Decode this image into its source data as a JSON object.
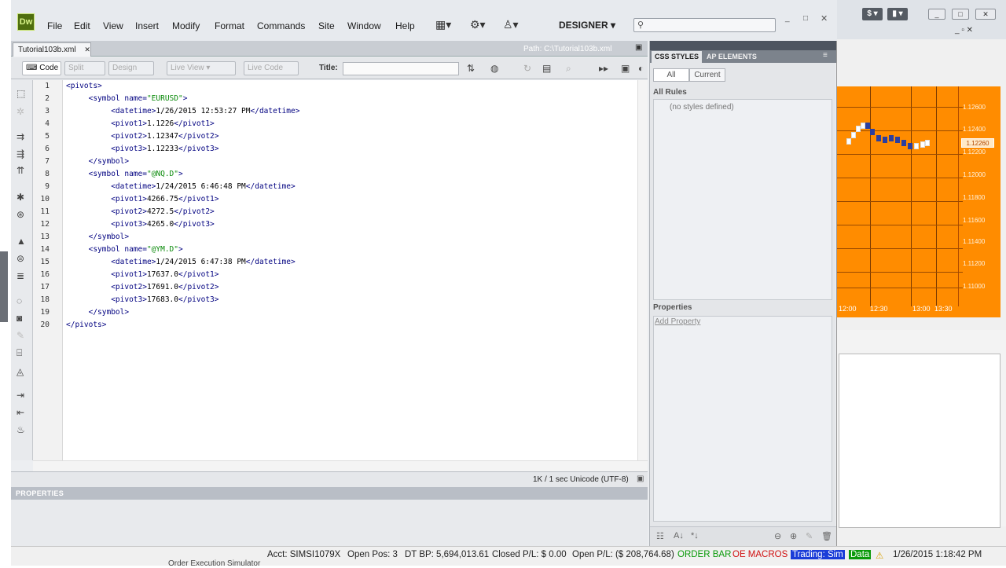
{
  "app": {
    "logo": "Dw",
    "menu": [
      "File",
      "Edit",
      "View",
      "Insert",
      "Modify",
      "Format",
      "Commands",
      "Site",
      "Window",
      "Help"
    ],
    "workspace": "DESIGNER",
    "search_placeholder": ""
  },
  "document": {
    "tab": "Tutorial103b.xml",
    "path": "Path:  C:\\Tutorial103b.xml",
    "toolbar": {
      "code": "Code",
      "split": "Split",
      "design": "Design",
      "live_view": "Live View",
      "live_code": "Live Code",
      "title_label": "Title:",
      "title_value": ""
    },
    "line_numbers": [
      "1",
      "2",
      "3",
      "4",
      "5",
      "6",
      "7",
      "8",
      "9",
      "10",
      "11",
      "12",
      "13",
      "14",
      "15",
      "16",
      "17",
      "18",
      "19",
      "20"
    ],
    "code_lines": [
      [
        {
          "t": "<pivots>",
          "c": "tg"
        }
      ],
      [
        {
          "t": "     <symbol name=",
          "c": "tg"
        },
        {
          "t": "\"EURUSD\"",
          "c": "av"
        },
        {
          "t": ">",
          "c": "tg"
        }
      ],
      [
        {
          "t": "          <datetime>",
          "c": "tg"
        },
        {
          "t": "1/26/2015 12:53:27 PM",
          "c": "tx"
        },
        {
          "t": "</datetime>",
          "c": "tg"
        }
      ],
      [
        {
          "t": "          <pivot1>",
          "c": "tg"
        },
        {
          "t": "1.1226",
          "c": "tx"
        },
        {
          "t": "</pivot1>",
          "c": "tg"
        }
      ],
      [
        {
          "t": "          <pivot2>",
          "c": "tg"
        },
        {
          "t": "1.12347",
          "c": "tx"
        },
        {
          "t": "</pivot2>",
          "c": "tg"
        }
      ],
      [
        {
          "t": "          <pivot3>",
          "c": "tg"
        },
        {
          "t": "1.12233",
          "c": "tx"
        },
        {
          "t": "</pivot3>",
          "c": "tg"
        }
      ],
      [
        {
          "t": "     </symbol>",
          "c": "tg"
        }
      ],
      [
        {
          "t": "     <symbol name=",
          "c": "tg"
        },
        {
          "t": "\"@NQ.D\"",
          "c": "av"
        },
        {
          "t": ">",
          "c": "tg"
        }
      ],
      [
        {
          "t": "          <datetime>",
          "c": "tg"
        },
        {
          "t": "1/24/2015 6:46:48 PM",
          "c": "tx"
        },
        {
          "t": "</datetime>",
          "c": "tg"
        }
      ],
      [
        {
          "t": "          <pivot1>",
          "c": "tg"
        },
        {
          "t": "4266.75",
          "c": "tx"
        },
        {
          "t": "</pivot1>",
          "c": "tg"
        }
      ],
      [
        {
          "t": "          <pivot2>",
          "c": "tg"
        },
        {
          "t": "4272.5",
          "c": "tx"
        },
        {
          "t": "</pivot2>",
          "c": "tg"
        }
      ],
      [
        {
          "t": "          <pivot3>",
          "c": "tg"
        },
        {
          "t": "4265.0",
          "c": "tx"
        },
        {
          "t": "</pivot3>",
          "c": "tg"
        }
      ],
      [
        {
          "t": "     </symbol>",
          "c": "tg"
        }
      ],
      [
        {
          "t": "     <symbol name=",
          "c": "tg"
        },
        {
          "t": "\"@YM.D\"",
          "c": "av"
        },
        {
          "t": ">",
          "c": "tg"
        }
      ],
      [
        {
          "t": "          <datetime>",
          "c": "tg"
        },
        {
          "t": "1/24/2015 6:47:38 PM",
          "c": "tx"
        },
        {
          "t": "</datetime>",
          "c": "tg"
        }
      ],
      [
        {
          "t": "          <pivot1>",
          "c": "tg"
        },
        {
          "t": "17637.0",
          "c": "tx"
        },
        {
          "t": "</pivot1>",
          "c": "tg"
        }
      ],
      [
        {
          "t": "          <pivot2>",
          "c": "tg"
        },
        {
          "t": "17691.0",
          "c": "tx"
        },
        {
          "t": "</pivot2>",
          "c": "tg"
        }
      ],
      [
        {
          "t": "          <pivot3>",
          "c": "tg"
        },
        {
          "t": "17683.0",
          "c": "tx"
        },
        {
          "t": "</pivot3>",
          "c": "tg"
        }
      ],
      [
        {
          "t": "     </symbol>",
          "c": "tg"
        }
      ],
      [
        {
          "t": "</pivots>",
          "c": "tg"
        }
      ]
    ],
    "status": "1K / 1 sec  Unicode (UTF-8)",
    "properties_label": "PROPERTIES"
  },
  "css_panel": {
    "tabs": [
      "CSS STYLES",
      "AP ELEMENTS"
    ],
    "mode_all": "All",
    "mode_current": "Current",
    "all_rules_label": "All Rules",
    "no_styles": "(no styles defined)",
    "properties_label": "Properties",
    "add_property": "Add Property"
  },
  "chart": {
    "price_labels": [
      "1.12600",
      "1.12400",
      "1.12200",
      "1.12000",
      "1.11800",
      "1.11600",
      "1.11400",
      "1.11200",
      "1.11000"
    ],
    "current_price": "1.12260",
    "time_labels": [
      "12:00",
      "12:30",
      "13:00",
      "13:30"
    ]
  },
  "taskbar": {
    "account": "Acct: SIMSI1079X",
    "open_pos": "Open Pos: 3",
    "dt_bp": "DT BP: 5,694,013.61",
    "closed_pl": "Closed P/L: $ 0.00",
    "open_pl": "Open P/L: ($ 208,764.68)",
    "order_bar": "ORDER BAR",
    "oe_macros": "OE MACROS",
    "trading": "Trading: Sim",
    "data": "Data",
    "datetime": "1/26/2015 1:18:42 PM",
    "bottom_window": "Order Execution Simulator"
  },
  "colors": {
    "chart_bg": "#ff8c00",
    "bar_blue": "#2b3fa0",
    "order_bar": "#0a9a0a",
    "oe_macros": "#d01010",
    "trading_bg": "#1a3cd8",
    "data_bg": "#0a9a0a",
    "dw_logo": "#4f6e0f"
  },
  "icons": [
    "close-icon",
    "minimize-icon",
    "maximize-icon",
    "search-icon",
    "gear-icon",
    "user-icon",
    "layout-icon",
    "refresh-icon",
    "file-management-icon",
    "browser-preview-icon",
    "validate-icon",
    "check-page-icon",
    "open-documents-icon",
    "collapse-icon",
    "expand-icon",
    "select-parent-tag-icon",
    "balance-braces-icon",
    "line-numbers-icon",
    "highlight-invalid-icon",
    "wrap-icon",
    "comment-icon",
    "indent-icon",
    "outdent-icon",
    "format-icon",
    "new-rule-icon",
    "edit-rule-icon",
    "delete-rule-icon",
    "attach-style-icon",
    "warning-icon"
  ]
}
